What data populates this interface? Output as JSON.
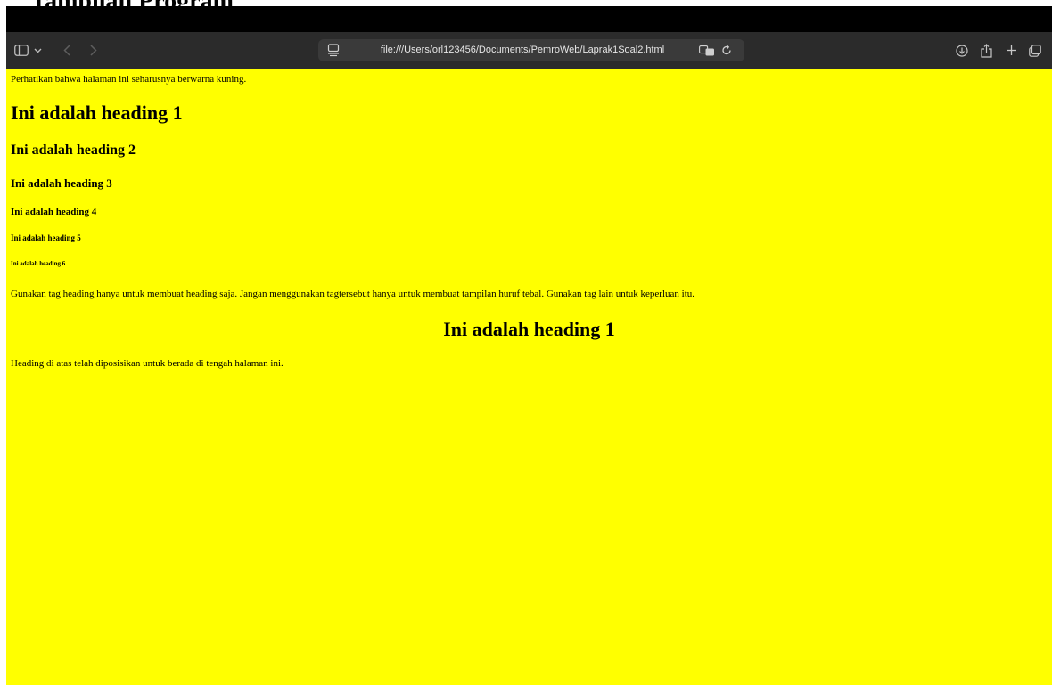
{
  "document": {
    "caption": "Tampilan Program"
  },
  "browser": {
    "url": "file:///Users/orl123456/Documents/PemroWeb/Laprak1Soal2.html",
    "icons": {
      "sidebar": "sidebar-icon",
      "chevron": "chevron-down-icon",
      "back": "back-icon",
      "forward": "forward-icon",
      "page": "page-icon",
      "translate": "translate-icon",
      "reload": "reload-icon",
      "download": "download-icon",
      "share": "share-icon",
      "new_tab": "plus-icon",
      "tabs": "tabs-icon"
    },
    "colors": {
      "toolbar": "#2b2b2b",
      "address_bar": "#3a3a3a",
      "page_background": "#ffff00"
    }
  },
  "page": {
    "intro": "Perhatikan bahwa halaman ini seharusnya berwarna kuning.",
    "h1": "Ini adalah heading 1",
    "h2": "Ini adalah heading 2",
    "h3": "Ini adalah heading 3",
    "h4": "Ini adalah heading 4",
    "h5": "Ini adalah heading 5",
    "h6": "Ini adalah heading 6",
    "note": "Gunakan tag heading hanya untuk membuat heading saja. Jangan menggunakan tagtersebut hanya untuk membuat tampilan huruf tebal. Gunakan tag lain untuk keperluan itu.",
    "h1_centered": "Ini adalah heading 1",
    "after": "Heading di atas telah diposisikan untuk berada di tengah halaman ini."
  }
}
